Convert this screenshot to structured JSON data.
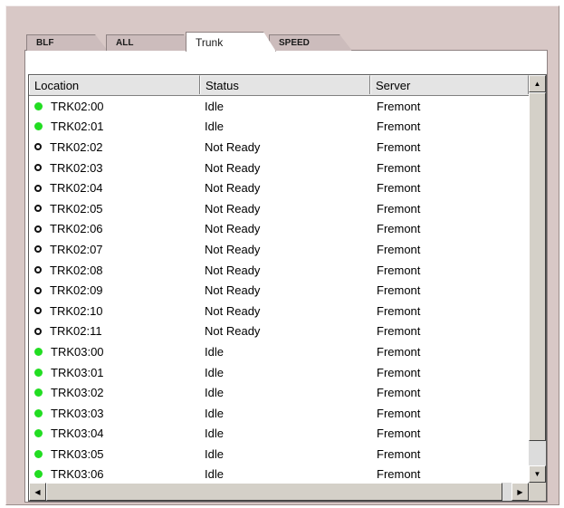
{
  "tabs": [
    {
      "label": "BLF"
    },
    {
      "label": "ALL"
    },
    {
      "label": "Trunk"
    },
    {
      "label": "SPEED"
    }
  ],
  "active_tab": "Trunk",
  "columns": {
    "location": "Location",
    "status": "Status",
    "server": "Server"
  },
  "status_colors": {
    "idle": "#22dd22",
    "not_ready": "#111111"
  },
  "rows": [
    {
      "location": "TRK02:00",
      "status": "Idle",
      "server": "Fremont",
      "indicator": "green-dot"
    },
    {
      "location": "TRK02:01",
      "status": "Idle",
      "server": "Fremont",
      "indicator": "green-dot"
    },
    {
      "location": "TRK02:02",
      "status": "Not Ready",
      "server": "Fremont",
      "indicator": "black-ring"
    },
    {
      "location": "TRK02:03",
      "status": "Not Ready",
      "server": "Fremont",
      "indicator": "black-ring"
    },
    {
      "location": "TRK02:04",
      "status": "Not Ready",
      "server": "Fremont",
      "indicator": "black-ring"
    },
    {
      "location": "TRK02:05",
      "status": "Not Ready",
      "server": "Fremont",
      "indicator": "black-ring"
    },
    {
      "location": "TRK02:06",
      "status": "Not Ready",
      "server": "Fremont",
      "indicator": "black-ring"
    },
    {
      "location": "TRK02:07",
      "status": "Not Ready",
      "server": "Fremont",
      "indicator": "black-ring"
    },
    {
      "location": "TRK02:08",
      "status": "Not Ready",
      "server": "Fremont",
      "indicator": "black-ring"
    },
    {
      "location": "TRK02:09",
      "status": "Not Ready",
      "server": "Fremont",
      "indicator": "black-ring"
    },
    {
      "location": "TRK02:10",
      "status": "Not Ready",
      "server": "Fremont",
      "indicator": "black-ring"
    },
    {
      "location": "TRK02:11",
      "status": "Not Ready",
      "server": "Fremont",
      "indicator": "black-ring"
    },
    {
      "location": "TRK03:00",
      "status": "Idle",
      "server": "Fremont",
      "indicator": "green-dot"
    },
    {
      "location": "TRK03:01",
      "status": "Idle",
      "server": "Fremont",
      "indicator": "green-dot"
    },
    {
      "location": "TRK03:02",
      "status": "Idle",
      "server": "Fremont",
      "indicator": "green-dot"
    },
    {
      "location": "TRK03:03",
      "status": "Idle",
      "server": "Fremont",
      "indicator": "green-dot"
    },
    {
      "location": "TRK03:04",
      "status": "Idle",
      "server": "Fremont",
      "indicator": "green-dot"
    },
    {
      "location": "TRK03:05",
      "status": "Idle",
      "server": "Fremont",
      "indicator": "green-dot"
    },
    {
      "location": "TRK03:06",
      "status": "Idle",
      "server": "Fremont",
      "indicator": "green-dot"
    }
  ],
  "scroll": {
    "up_icon": "arrow-up-icon",
    "down_icon": "arrow-down-icon",
    "left_icon": "arrow-left-icon",
    "right_icon": "arrow-right-icon"
  }
}
